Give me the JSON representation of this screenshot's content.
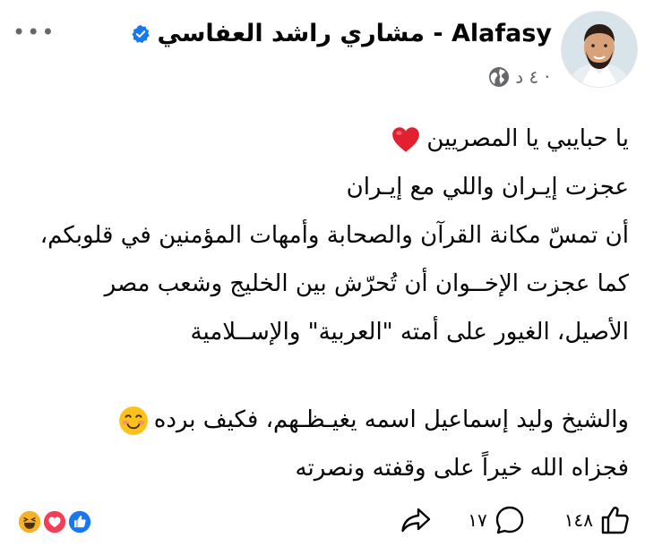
{
  "post": {
    "author_name": "مشاري راشد العفاسي - Alafasy",
    "timestamp": "٤ د ·",
    "audience_icon": "globe-icon",
    "lines": [
      "يا حبايبي يا المصريين",
      "عجزت إيـران واللي مع إيـران",
      "أن تمسّ مكانة القرآن والصحابة وأمهات المؤمنين في قلوبكم،",
      "كما عجزت الإخــوان أن تُحرّش بين الخليج وشعب مصر",
      "الأصيل، الغيور على أمته \"العربية\" والإســلامية",
      "",
      "والشيخ وليد إسماعيل اسمه يغيـظـهم، فكيف برده",
      "فجزاه الله خيراً على وقفته ونصرته"
    ]
  },
  "footer": {
    "like_count": "١٤٨",
    "comment_count": "١٧",
    "reactions": [
      "haha",
      "love",
      "like"
    ]
  },
  "colors": {
    "verified_blue": "#1877f2",
    "like_blue": "#1877f2",
    "love_red": "#f33e58",
    "haha_yellow": "#f7b125",
    "secondary_text": "#65676b"
  }
}
